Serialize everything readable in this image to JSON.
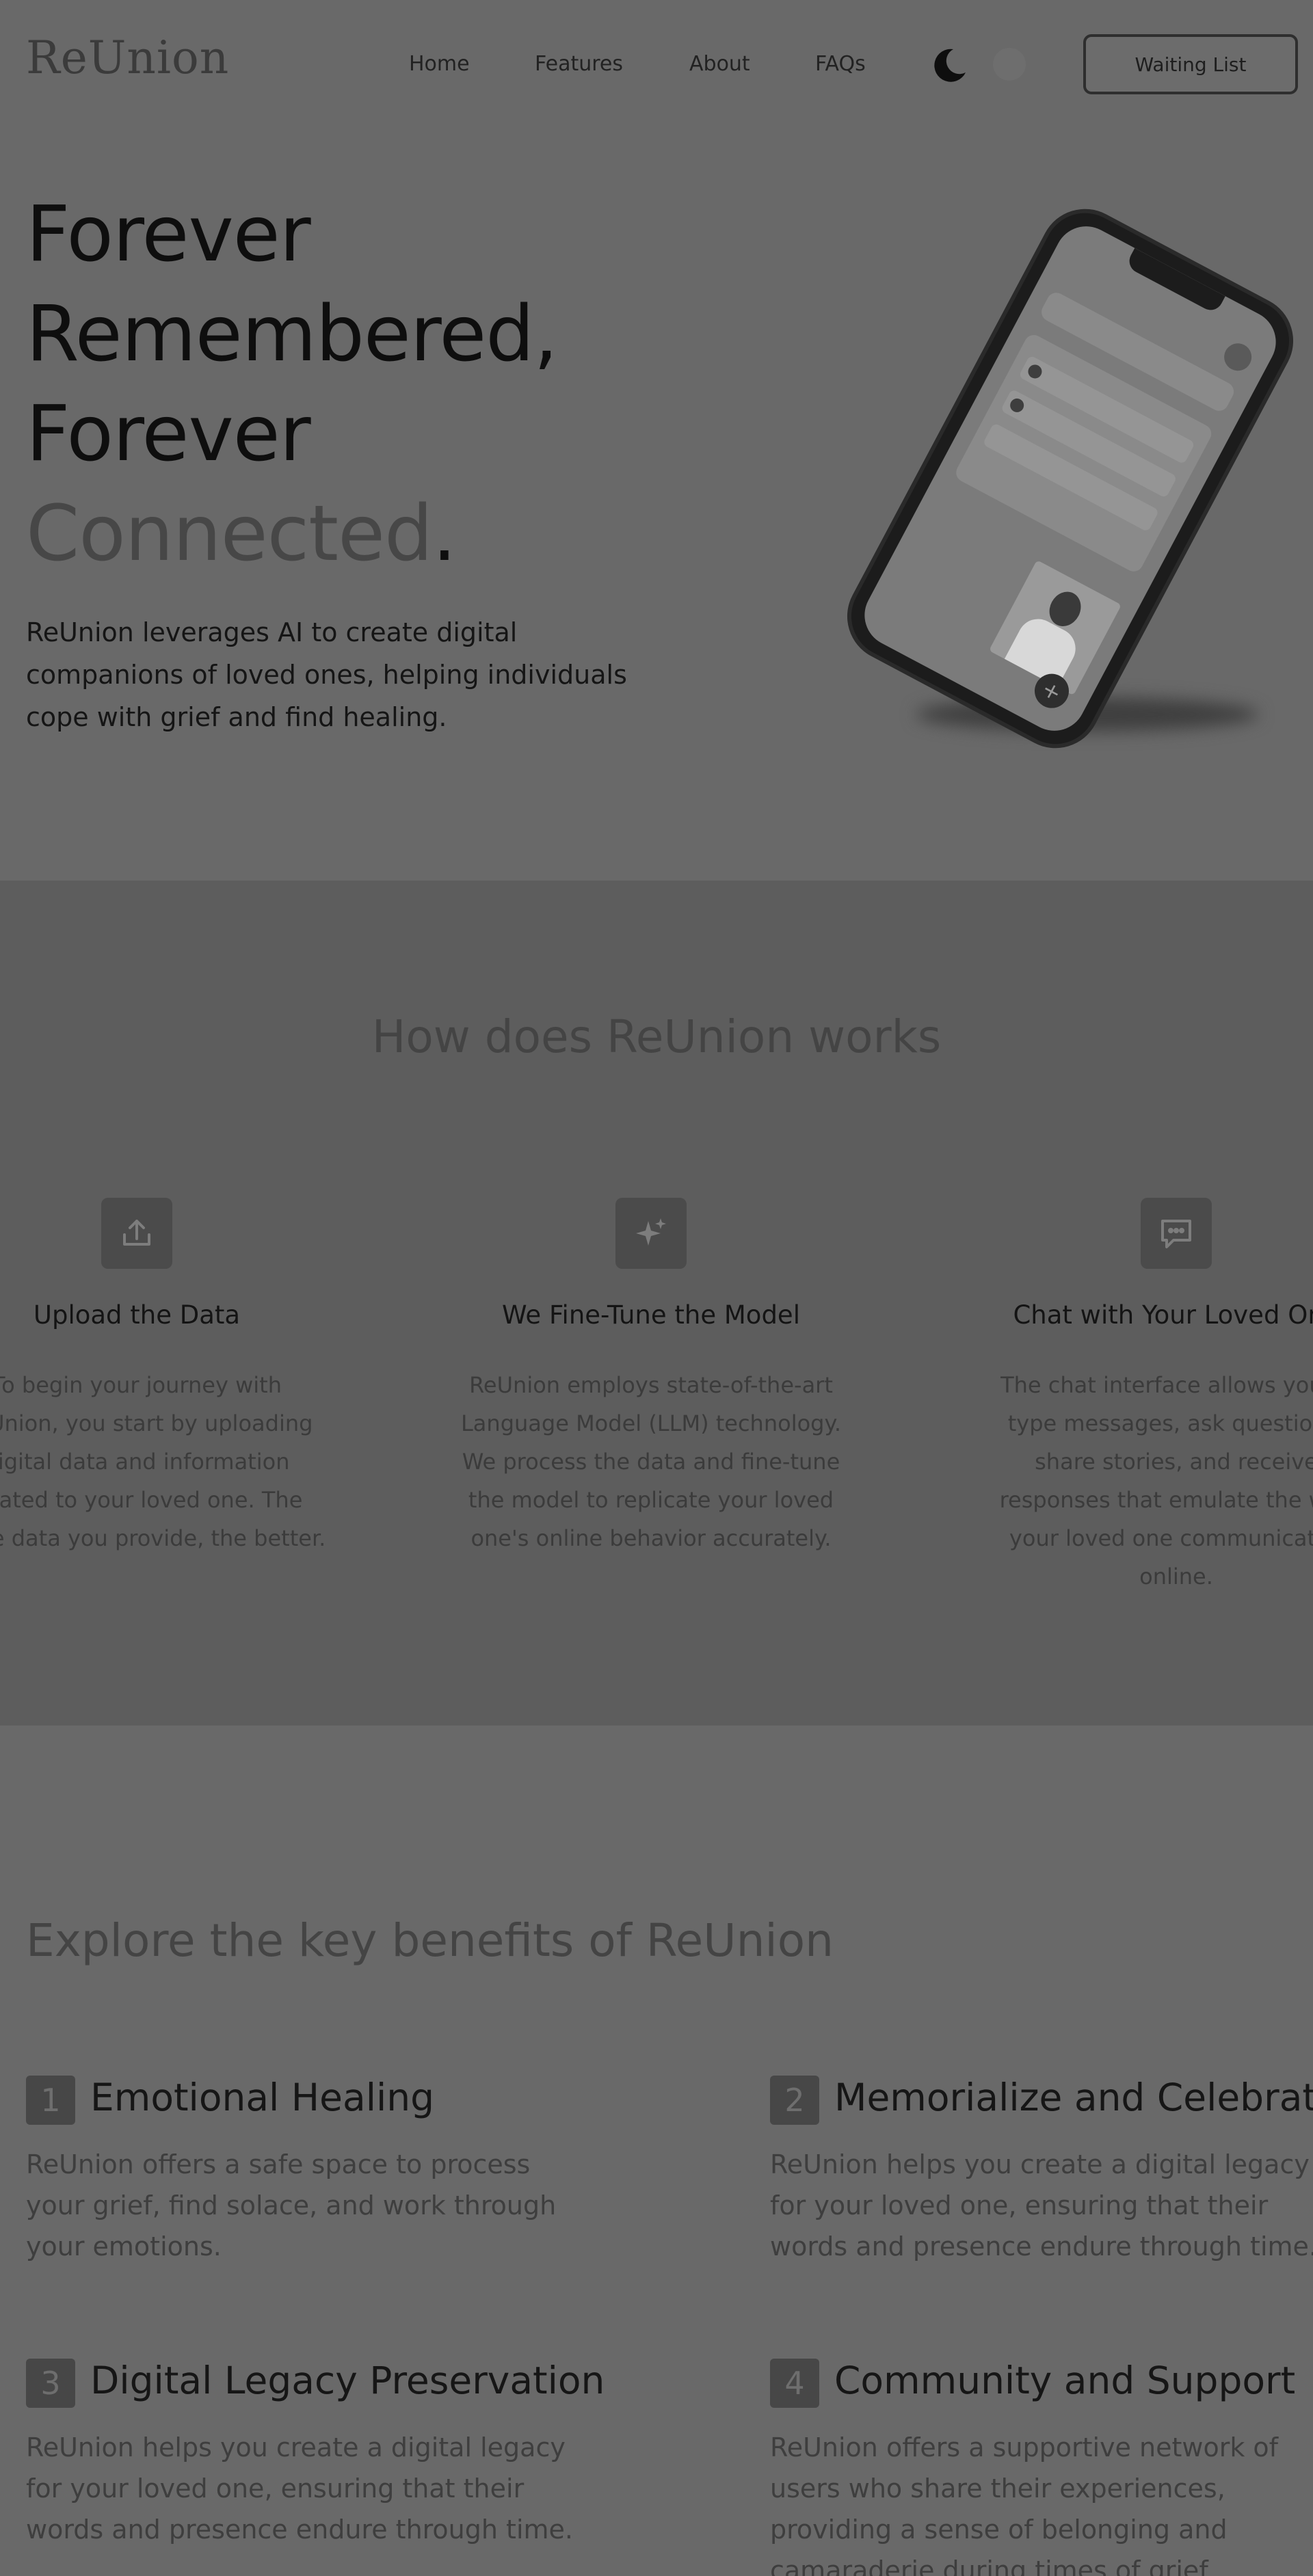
{
  "nav": {
    "logo": "ReUnion",
    "links": [
      "Home",
      "Features",
      "About",
      "FAQs"
    ],
    "waiting_list": "Waiting List"
  },
  "hero": {
    "title_lines": [
      "Forever",
      "Remembered,",
      "Forever"
    ],
    "title_highlight": "Connected",
    "title_period": ".",
    "subtitle": "ReUnion leverages AI to create digital companions of loved ones, helping individuals cope with grief and find healing."
  },
  "how": {
    "heading": "How does ReUnion works",
    "steps": [
      {
        "icon": "upload-icon",
        "title": "Upload the Data",
        "desc": "To begin your journey with ReUnion, you start by uploading digital data and information related to your loved one. The more data you provide, the better."
      },
      {
        "icon": "sparkle-icon",
        "title": "We Fine-Tune the Model",
        "desc": "ReUnion employs state-of-the-art Language Model (LLM) technology. We process the data and fine-tune the model to replicate your loved one's online behavior accurately."
      },
      {
        "icon": "chat-icon",
        "title": "Chat with Your Loved One",
        "desc": "The chat interface allows you to type messages, ask questions, share stories, and receive responses that emulate the way your loved one communicated online."
      }
    ]
  },
  "benefits": {
    "heading": "Explore the key benefits of ReUnion",
    "items": [
      {
        "num": "1",
        "title": "Emotional Healing",
        "desc": "ReUnion offers a safe space to process your grief, find solace, and work through your emotions."
      },
      {
        "num": "2",
        "title": "Memorialize and Celebrate",
        "desc": "ReUnion helps you create a digital legacy for your loved one, ensuring that their words and presence endure through time."
      },
      {
        "num": "3",
        "title": "Digital Legacy Preservation",
        "desc": "ReUnion helps you create a digital legacy for your loved one, ensuring that their words and presence endure through time."
      },
      {
        "num": "4",
        "title": "Community and Support",
        "desc": "ReUnion offers a supportive network of users who share their experiences, providing a sense of belonging and camaraderie during times of grief."
      }
    ]
  }
}
